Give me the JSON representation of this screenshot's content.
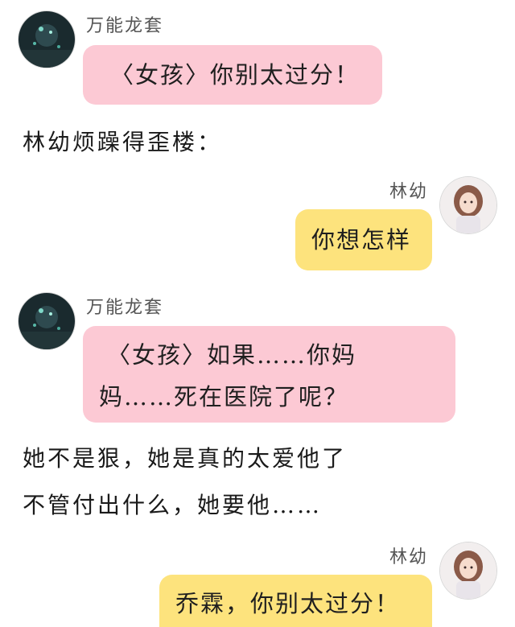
{
  "messages": [
    {
      "sender": "万能龙套",
      "text": "〈女孩〉你别太过分！"
    },
    {
      "narration": "林幼烦躁得歪楼："
    },
    {
      "sender": "林幼",
      "text": "你想怎样"
    },
    {
      "sender": "万能龙套",
      "text_line1": "〈女孩〉如果……你妈",
      "text_line2": "妈……死在医院了呢？"
    },
    {
      "narration": "她不是狠，她是真的太爱他了"
    },
    {
      "narration": "不管付出什么，她要他……"
    },
    {
      "sender": "林幼",
      "text": "乔霖，你别太过分！"
    }
  ],
  "colors": {
    "pink_bubble": "#fcc9d4",
    "yellow_bubble": "#fde37d"
  },
  "icons": {
    "left_avatar": "dark-night-sky-avatar",
    "right_avatar": "girl-photo-avatar"
  }
}
